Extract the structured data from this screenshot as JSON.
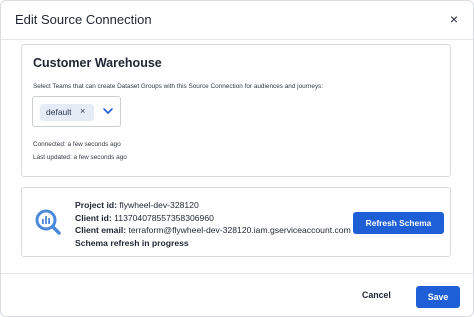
{
  "dialog": {
    "title": "Edit Source Connection",
    "close_label": "×"
  },
  "source": {
    "name": "Customer Warehouse",
    "teams_label": "Select Teams that can create Dataset Groups with this Source Connection for audiences and journeys:",
    "selected_team": "default",
    "chip_remove_label": "×",
    "connected": "Connected: a few seconds ago",
    "last_updated": "Last updated: a few seconds ago"
  },
  "schema": {
    "icon": "bigquery-icon",
    "project_id_label": "Project id:",
    "project_id": "flywheel-dev-328120",
    "client_id_label": "Client id:",
    "client_id": "113704078557358306960",
    "client_email_label": "Client email:",
    "client_email": "terraform@flywheel-dev-328120.iam.gserviceaccount.com",
    "status": "Schema refresh in progress",
    "refresh_label": "Refresh Schema"
  },
  "footer": {
    "cancel_label": "Cancel",
    "save_label": "Save"
  },
  "colors": {
    "primary": "#1e5fd8",
    "chip_bg": "#e6ecf5",
    "bigquery_blue": "#4a89dc"
  }
}
